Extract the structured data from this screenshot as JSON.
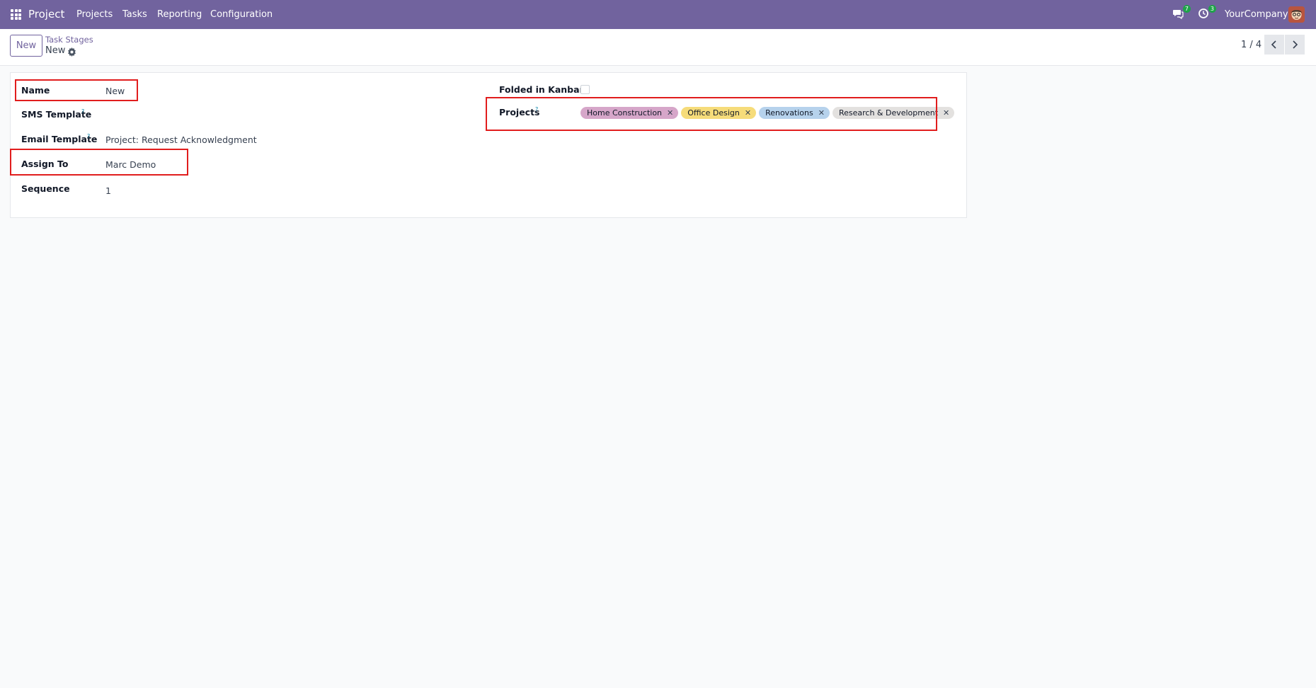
{
  "navbar": {
    "app_name": "Project",
    "menu": [
      "Projects",
      "Tasks",
      "Reporting",
      "Configuration"
    ],
    "messages_count": "7",
    "activities_count": "3",
    "company": "YourCompany"
  },
  "control": {
    "new_label": "New",
    "breadcrumb_parent": "Task Stages",
    "breadcrumb_current": "New",
    "pager": "1 / 4"
  },
  "form": {
    "left": {
      "name_label": "Name",
      "name_value": "New",
      "sms_label": "SMS Template",
      "sms_help": "?",
      "email_label": "Email Template",
      "email_help": "?",
      "email_value": "Project: Request Acknowledgment",
      "assign_label": "Assign To",
      "assign_value": "Marc Demo",
      "sequence_label": "Sequence",
      "sequence_value": "1"
    },
    "right": {
      "folded_label": "Folded in Kanban",
      "folded_checked": false,
      "projects_label": "Projects",
      "projects_help": "?",
      "projects": [
        {
          "label": "Home Construction",
          "color": "#d6a6c9"
        },
        {
          "label": "Office Design",
          "color": "#f6dc7a"
        },
        {
          "label": "Renovations",
          "color": "#b6d2ec"
        },
        {
          "label": "Research & Development",
          "color": "#e3e1df"
        }
      ],
      "remove_glyph": "✕"
    }
  },
  "colors": {
    "brand": "#71639e",
    "highlight": "#e11d1d",
    "badge": "#1fa34a"
  }
}
